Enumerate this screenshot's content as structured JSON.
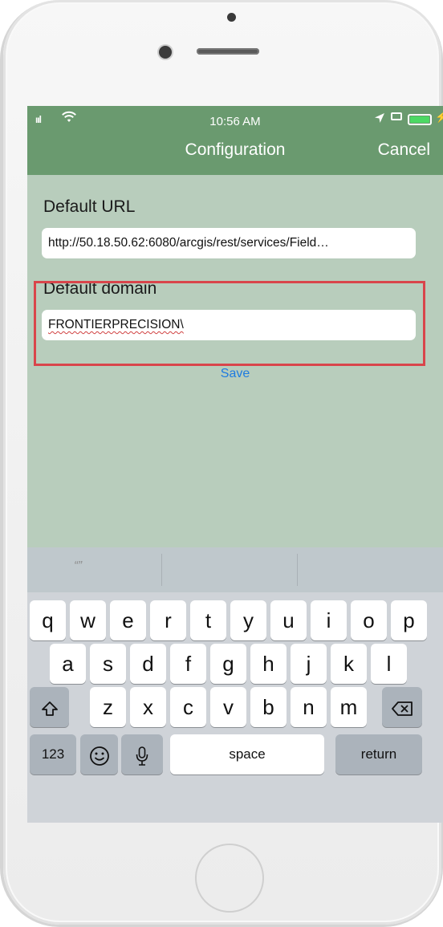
{
  "status_bar": {
    "signal": "ııl",
    "wifi_icon": "wifi-icon",
    "time": "10:56 AM",
    "location_icon": "location-arrow-icon",
    "battery_icon": "battery-charging-icon"
  },
  "nav": {
    "title": "Configuration",
    "cancel": "Cancel"
  },
  "form": {
    "url_label": "Default URL",
    "url_value": "http://50.18.50.62:6080/arcgis/rest/services/Field…",
    "domain_label": "Default domain",
    "domain_value": "FRONTIERPRECISION\\",
    "save": "Save"
  },
  "keyboard": {
    "suggestions": [
      "\"\"\"",
      "",
      ""
    ],
    "row1": [
      "q",
      "w",
      "e",
      "r",
      "t",
      "y",
      "u",
      "i",
      "o",
      "p"
    ],
    "row2": [
      "a",
      "s",
      "d",
      "f",
      "g",
      "h",
      "j",
      "k",
      "l"
    ],
    "row3": [
      "z",
      "x",
      "c",
      "v",
      "b",
      "n",
      "m"
    ],
    "shift": "⇧",
    "delete": "⌫",
    "numbers": "123",
    "emoji": "☺",
    "mic": "🎙",
    "space": "space",
    "return": "return"
  },
  "colors": {
    "nav_bar": "#6a9a6f",
    "screen_bg": "#b8cdbc",
    "highlight_border": "#d9454b",
    "save_link": "#1e7be0"
  }
}
